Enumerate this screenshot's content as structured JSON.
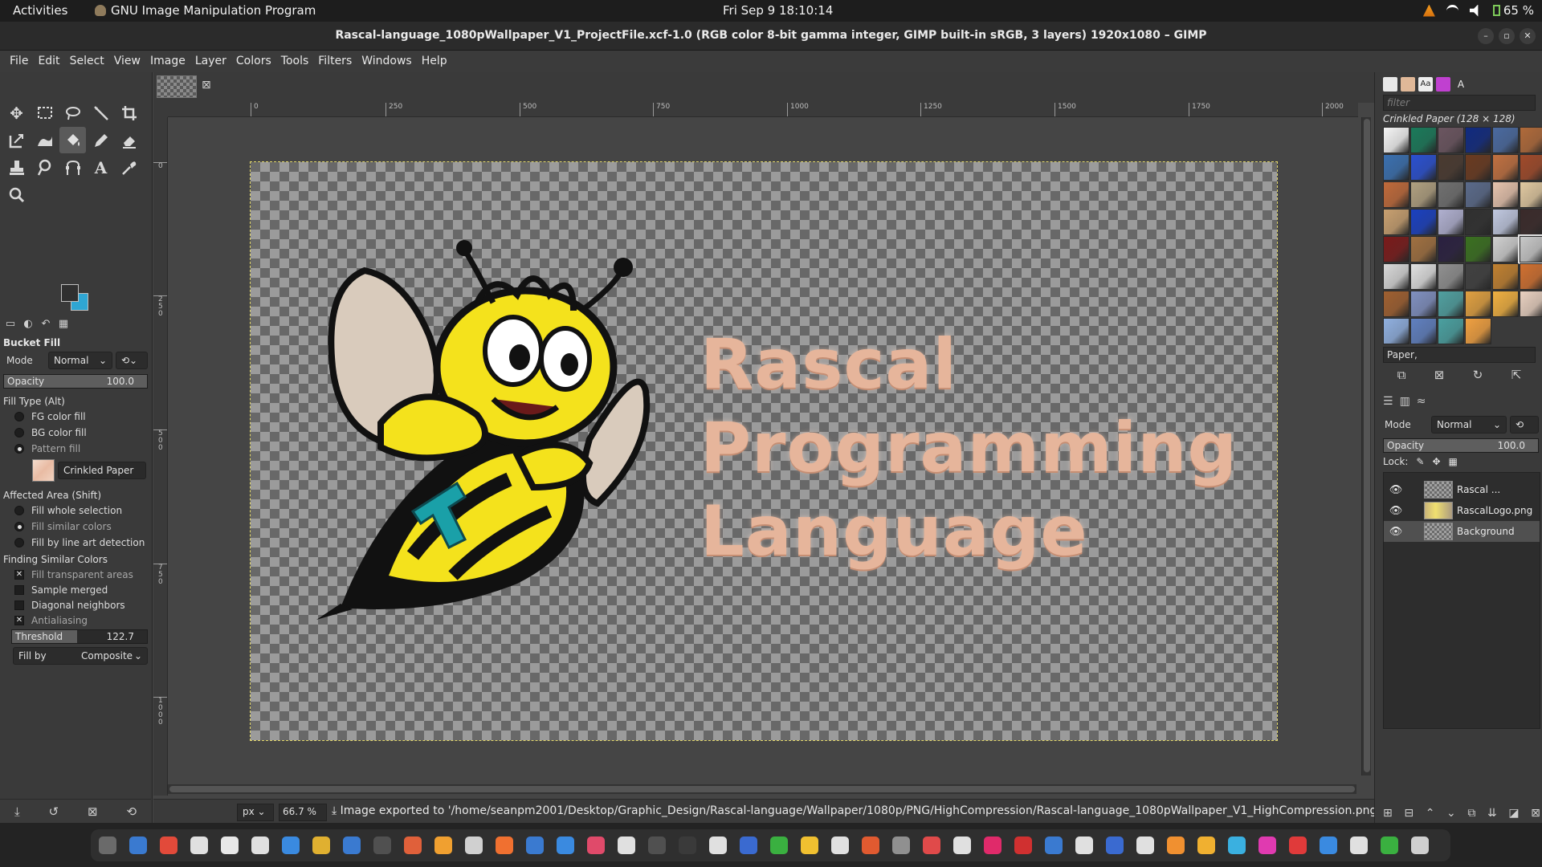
{
  "topbar": {
    "activities": "Activities",
    "app_name": "GNU Image Manipulation Program",
    "clock": "Fri Sep 9  18:10:14",
    "battery": "65 %"
  },
  "window": {
    "title": "Rascal-language_1080pWallpaper_V1_ProjectFile.xcf-1.0 (RGB color 8-bit gamma integer, GIMP built-in sRGB, 3 layers) 1920x1080 – GIMP"
  },
  "menu": [
    "File",
    "Edit",
    "Select",
    "View",
    "Image",
    "Layer",
    "Colors",
    "Tools",
    "Filters",
    "Windows",
    "Help"
  ],
  "tool_options": {
    "title": "Bucket Fill",
    "mode_label": "Mode",
    "mode_value": "Normal",
    "opacity_label": "Opacity",
    "opacity_value": "100.0",
    "fill_type_label": "Fill Type  (Alt)",
    "fill_types": [
      "FG color fill",
      "BG color fill",
      "Pattern fill"
    ],
    "pattern_name": "Crinkled Paper",
    "affected_label": "Affected Area  (Shift)",
    "affected": [
      "Fill whole selection",
      "Fill similar colors",
      "Fill by line art detection"
    ],
    "finding_label": "Finding Similar Colors",
    "finding": [
      "Fill transparent areas",
      "Sample merged",
      "Diagonal neighbors",
      "Antialiasing"
    ],
    "threshold_label": "Threshold",
    "threshold_value": "122.7",
    "threshold_fraction": 0.48,
    "fillby_label": "Fill by",
    "fillby_value": "Composite"
  },
  "canvas": {
    "ruler_h": [
      "0",
      "250",
      "500",
      "750",
      "1000",
      "1250",
      "1500",
      "1750",
      "2000"
    ],
    "ruler_v": [
      "0",
      "2 5 0",
      "5 0 0",
      "7 5 0",
      "1 0 0 0"
    ],
    "wordmark": [
      "Rascal",
      "Programming",
      "Language"
    ]
  },
  "status": {
    "unit": "px",
    "zoom": "66.7 %",
    "message": "Image exported to '/home/seanpm2001/Desktop/Graphic_Design/Rascal-language/Wallpaper/1080p/PNG/HighCompression/Rascal-language_1080pWallpaper_V1_HighCompression.png'"
  },
  "patterns": {
    "filter_placeholder": "filter",
    "selected": "Crinkled Paper (128 × 128)",
    "tag": "Paper,",
    "swatch_colors": [
      "#f5f5f5",
      "#1a7a5a",
      "#6b5560",
      "#102a80",
      "#4a6aa0",
      "#b06a3a",
      "#3a70b0",
      "#2a50d0",
      "#4a3a30",
      "#6a3a20",
      "#c07040",
      "#a04a2a",
      "#c06a3a",
      "#b0a080",
      "#707070",
      "#5a6a8a",
      "#e6c3ad",
      "#e0c8a0",
      "#c8a070",
      "#1a40c0",
      "#b0b0d0",
      "#303030",
      "#c0c8e0",
      "#3a2a2a",
      "#7a1a1a",
      "#a07040",
      "#2a2040",
      "#3a7020",
      "#d0d0d0",
      "#c8c8c8",
      "#d8d8d8",
      "#e0e0e0",
      "#909090",
      "#404040",
      "#c08030",
      "#d07030",
      "#a06030",
      "#8090c0",
      "#50a0a0",
      "#e0a040",
      "#f0b040",
      "#e8d0c0",
      "#90b0e0",
      "#6080c0",
      "#4aa0a0",
      "#f0a040"
    ]
  },
  "layers": {
    "mode_label": "Mode",
    "mode_value": "Normal",
    "opacity_label": "Opacity",
    "opacity_value": "100.0",
    "lock_label": "Lock:",
    "items": [
      {
        "name": "Rascal ..."
      },
      {
        "name": "RascalLogo.png"
      },
      {
        "name": "Background"
      }
    ]
  },
  "colors": {
    "fg": "#303030",
    "bg": "#2fa6d3",
    "text_orange": "#e6b59b"
  },
  "dock_apps": [
    "#6a6a6a",
    "#3a7ad0",
    "#e24a3a",
    "#e0e0e0",
    "#e8e8e8",
    "#e0e0e0",
    "#3a8ae0",
    "#e0b030",
    "#3a7ad0",
    "#505050",
    "#e0603a",
    "#f0a030",
    "#d0d0d0",
    "#f07030",
    "#3a7ad0",
    "#3a8ae0",
    "#e04a6a",
    "#e0e0e0",
    "#505050",
    "#3a3a3a",
    "#e0e0e0",
    "#3a6ad0",
    "#3ab040",
    "#f0c030",
    "#e0e0e0",
    "#e05a30",
    "#909090",
    "#e04a4a",
    "#e0e0e0",
    "#e02a6a",
    "#d03030",
    "#3a7ad0",
    "#e0e0e0",
    "#3a6ad0",
    "#e0e0e0",
    "#f09030",
    "#f0b030",
    "#3ab0e0",
    "#e03ab0",
    "#e03a3a",
    "#3a8ae0",
    "#e0e0e0",
    "#3ab040",
    "#d0d0d0"
  ]
}
